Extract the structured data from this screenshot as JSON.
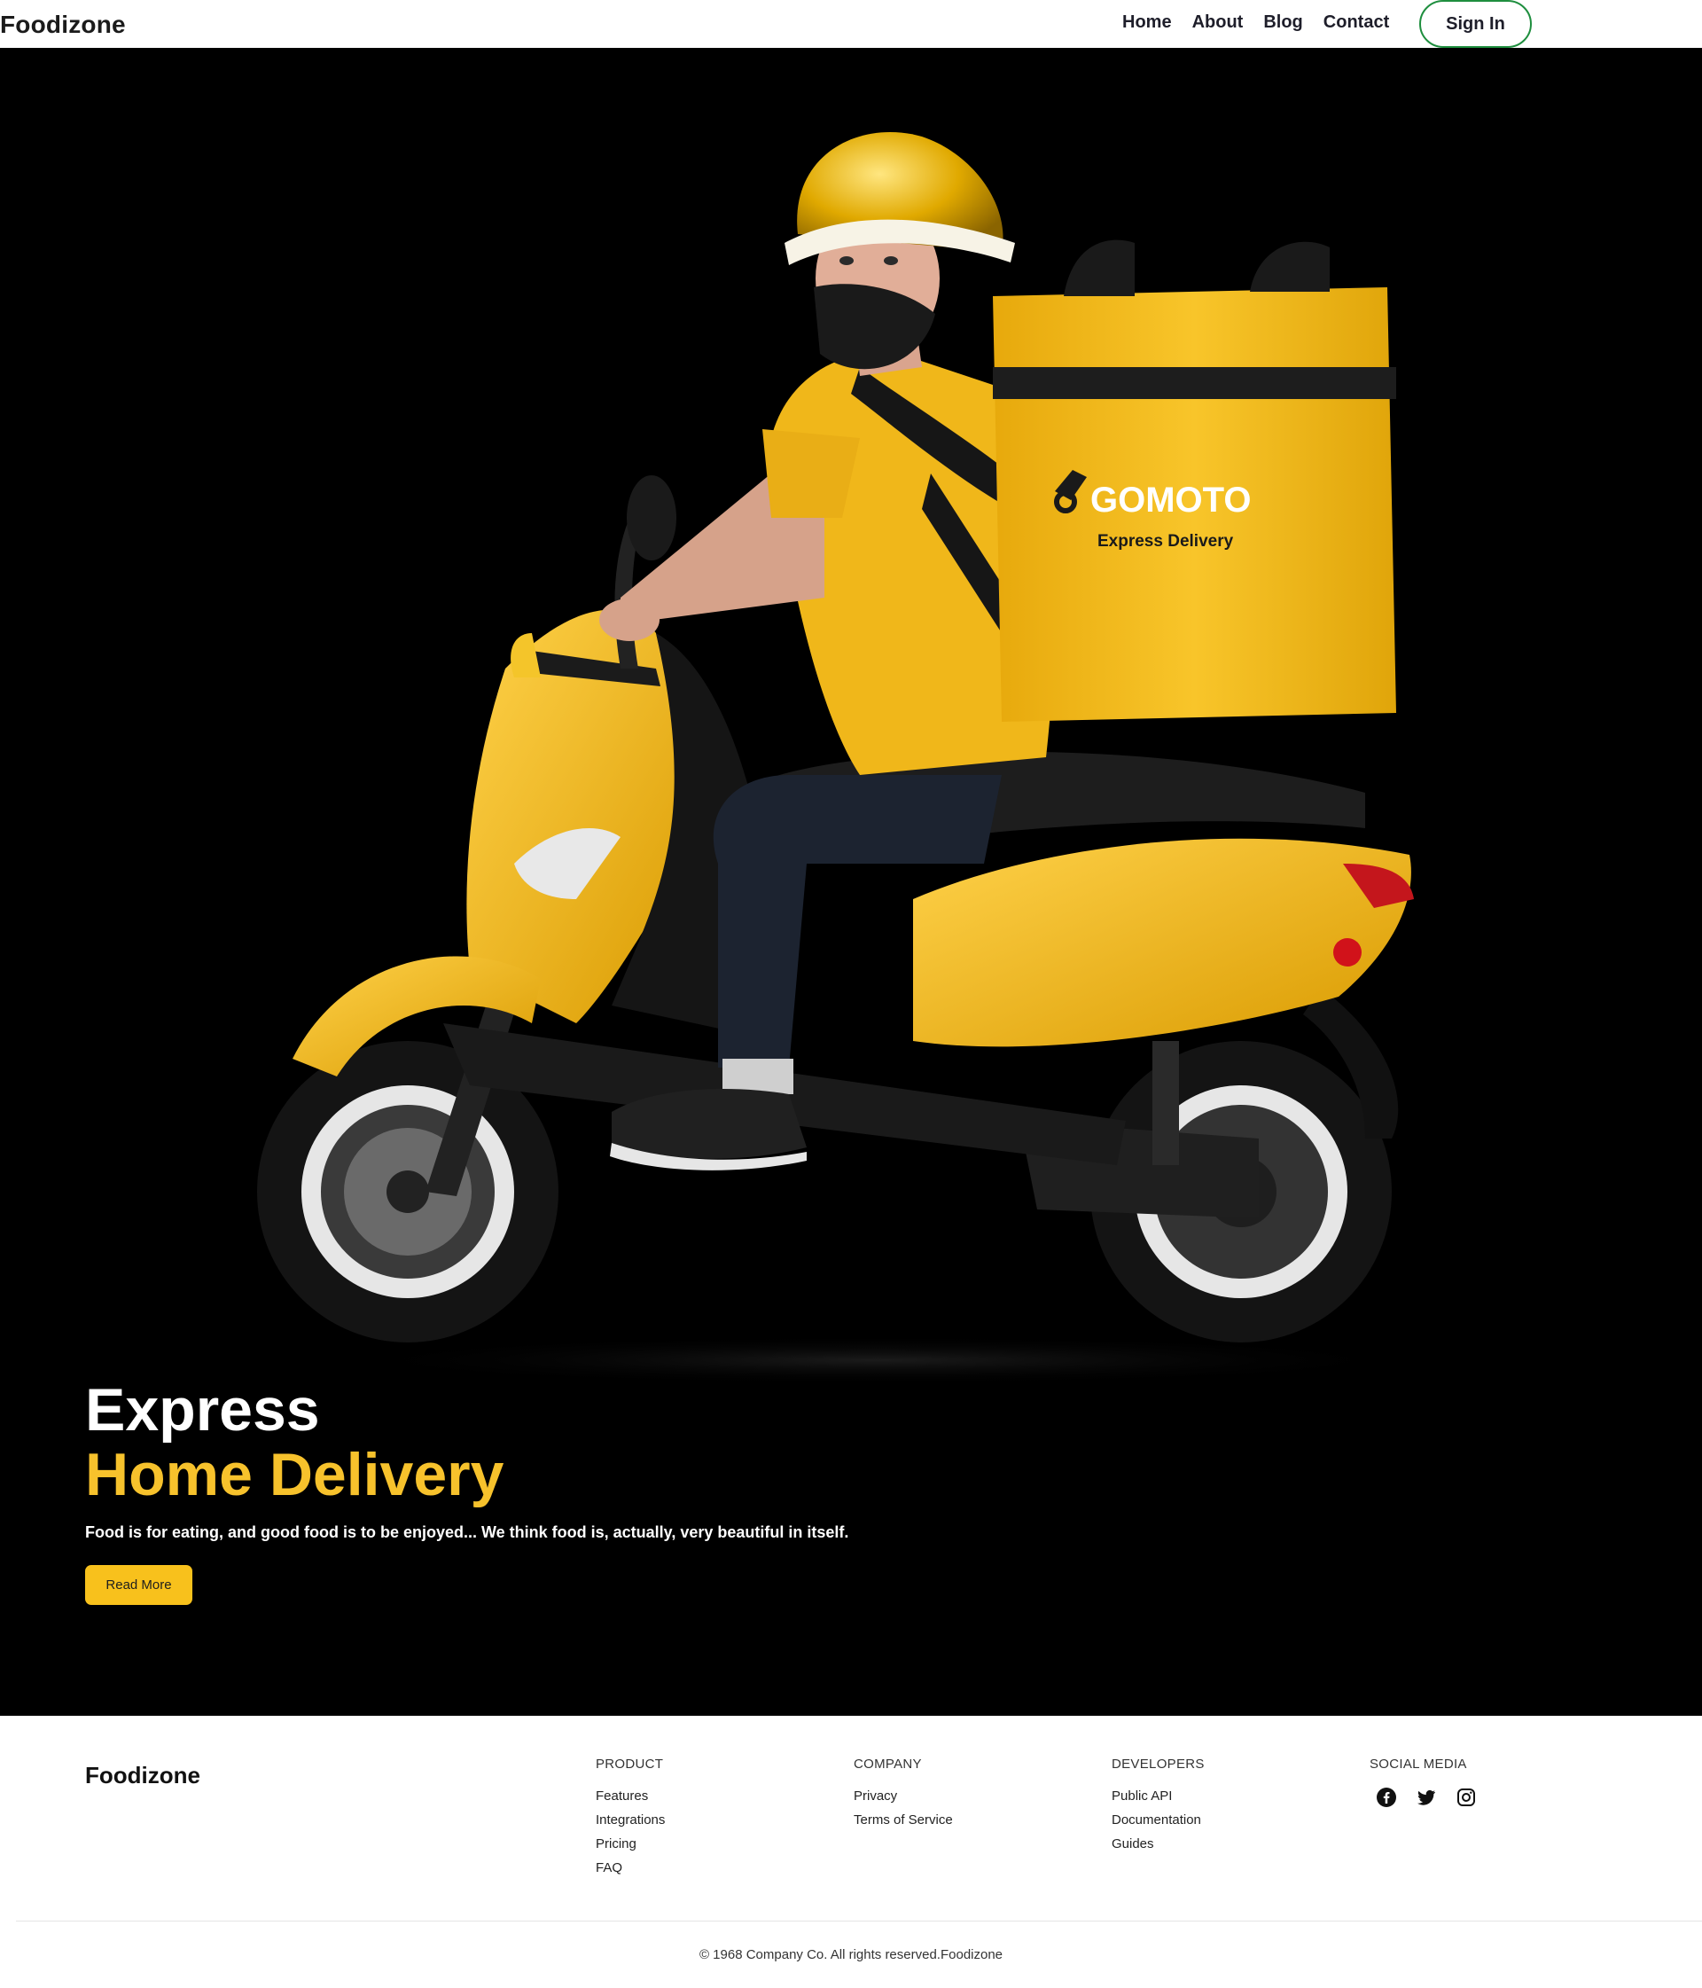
{
  "nav": {
    "brand": "Foodizone",
    "links": [
      "Home",
      "About",
      "Blog",
      "Contact"
    ],
    "signin": "Sign In"
  },
  "hero": {
    "title_line1": "Express",
    "title_line2": "Home Delivery",
    "description": "Food is for eating, and good food is to be enjoyed... We think food is, actually, very beautiful in itself.",
    "cta": "Read More",
    "bag_brand": "GOMOTO",
    "bag_tagline": "Express Delivery"
  },
  "footer": {
    "brand": "Foodizone",
    "columns": [
      {
        "heading": "PRODUCT",
        "items": [
          "Features",
          "Integrations",
          "Pricing",
          "FAQ"
        ]
      },
      {
        "heading": "COMPANY",
        "items": [
          "Privacy",
          "Terms of Service"
        ]
      },
      {
        "heading": "DEVELOPERS",
        "items": [
          "Public API",
          "Documentation",
          "Guides"
        ]
      }
    ],
    "social_heading": "SOCIAL MEDIA",
    "social_icons": [
      "facebook-icon",
      "twitter-icon",
      "instagram-icon"
    ],
    "copyright": "© 1968 Company Co. All rights reserved.Foodizone"
  },
  "colors": {
    "accent": "#f7c22c",
    "hero_bg": "#000000",
    "signin_border": "#1e8e3e"
  }
}
